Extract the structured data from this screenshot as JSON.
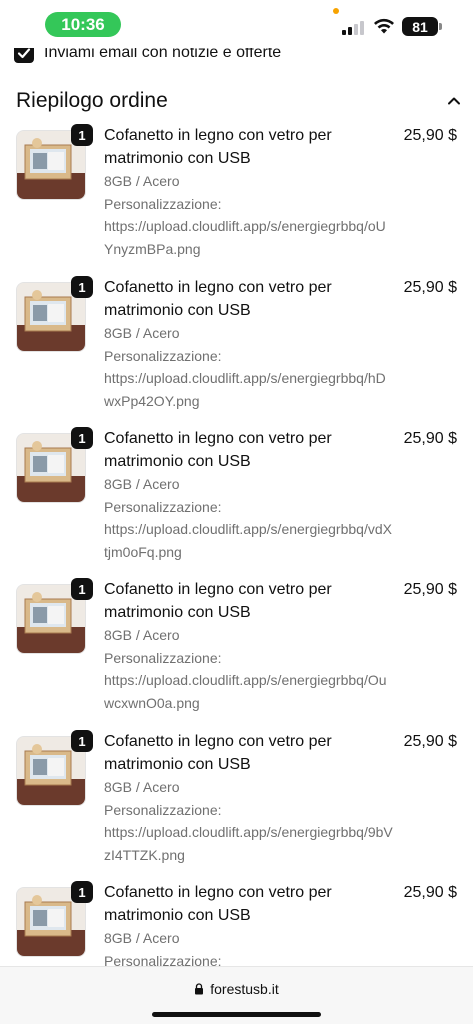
{
  "status_bar": {
    "time": "10:36",
    "battery": "81"
  },
  "newsletter": {
    "label": "Inviami email con notizie e offerte",
    "checked": true
  },
  "summary": {
    "title": "Riepilogo ordine"
  },
  "items": [
    {
      "qty": "1",
      "name": "Cofanetto in legno con vetro per matrimonio con USB",
      "variant": "8GB / Acero",
      "custom_label": "Personalizzazione:",
      "custom_url": "https://upload.cloudlift.app/s/energiegrbbq/oUYnyzmBPa.png",
      "price": "25,90 $"
    },
    {
      "qty": "1",
      "name": "Cofanetto in legno con vetro per matrimonio con USB",
      "variant": "8GB / Acero",
      "custom_label": "Personalizzazione:",
      "custom_url": "https://upload.cloudlift.app/s/energiegrbbq/hDwxPp42OY.png",
      "price": "25,90 $"
    },
    {
      "qty": "1",
      "name": "Cofanetto in legno con vetro per matrimonio con USB",
      "variant": "8GB / Acero",
      "custom_label": "Personalizzazione:",
      "custom_url": "https://upload.cloudlift.app/s/energiegrbbq/vdXtjm0oFq.png",
      "price": "25,90 $"
    },
    {
      "qty": "1",
      "name": "Cofanetto in legno con vetro per matrimonio con USB",
      "variant": "8GB / Acero",
      "custom_label": "Personalizzazione:",
      "custom_url": "https://upload.cloudlift.app/s/energiegrbbq/OuwcxwnO0a.png",
      "price": "25,90 $"
    },
    {
      "qty": "1",
      "name": "Cofanetto in legno con vetro per matrimonio con USB",
      "variant": "8GB / Acero",
      "custom_label": "Personalizzazione:",
      "custom_url": "https://upload.cloudlift.app/s/energiegrbbq/9bVzI4TTZK.png",
      "price": "25,90 $"
    },
    {
      "qty": "1",
      "name": "Cofanetto in legno con vetro per matrimonio con USB",
      "variant": "8GB / Acero",
      "custom_label": "Personalizzazione:",
      "custom_url": "",
      "price": "25,90 $"
    }
  ],
  "browser": {
    "url": "forestusb.it"
  },
  "colors": {
    "time_pill": "#34c759",
    "text": "#111111",
    "meta_text": "#707070",
    "recording_dot": "#f7a300"
  }
}
